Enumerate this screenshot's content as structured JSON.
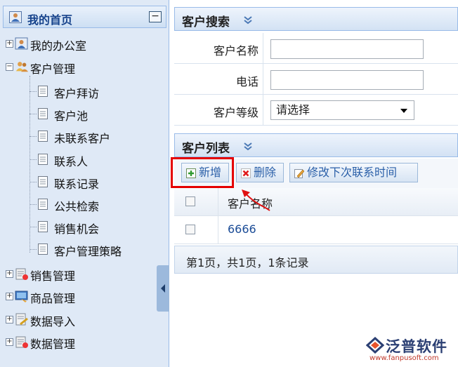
{
  "left_panel": {
    "title": "我的首页",
    "collapse_symbol": "−",
    "tree": [
      {
        "label": "我的办公室",
        "icon": "user-card-icon",
        "expanded": false
      },
      {
        "label": "客户管理",
        "icon": "users-folder-icon",
        "expanded": true,
        "children": [
          "客户拜访",
          "客户池",
          "未联系客户",
          "联系人",
          "联系记录",
          "公共检索",
          "销售机会",
          "客户管理策略"
        ]
      },
      {
        "label": "销售管理",
        "icon": "sales-icon",
        "expanded": false
      },
      {
        "label": "商品管理",
        "icon": "goods-icon",
        "expanded": false
      },
      {
        "label": "数据导入",
        "icon": "import-icon",
        "expanded": false
      },
      {
        "label": "数据管理",
        "icon": "data-icon",
        "expanded": false
      }
    ]
  },
  "search": {
    "title": "客户搜索",
    "fields": [
      {
        "label": "客户名称",
        "value": ""
      },
      {
        "label": "电话",
        "value": ""
      },
      {
        "label": "客户等级",
        "selected": "请选择"
      }
    ]
  },
  "list": {
    "title": "客户列表",
    "toolbar": {
      "add": "新增",
      "delete": "删除",
      "modify": "修改下次联系时间"
    },
    "columns": [
      "客户名称"
    ],
    "rows": [
      {
        "name": "6666"
      }
    ],
    "pager": "第1页，共1页，1条记录"
  },
  "logo": {
    "brand": "泛普软件",
    "url": "www.fanpusoft.com"
  },
  "colors": {
    "accent_border": "#99bbe8",
    "highlight": "#e50000",
    "link": "#1a4b96"
  }
}
